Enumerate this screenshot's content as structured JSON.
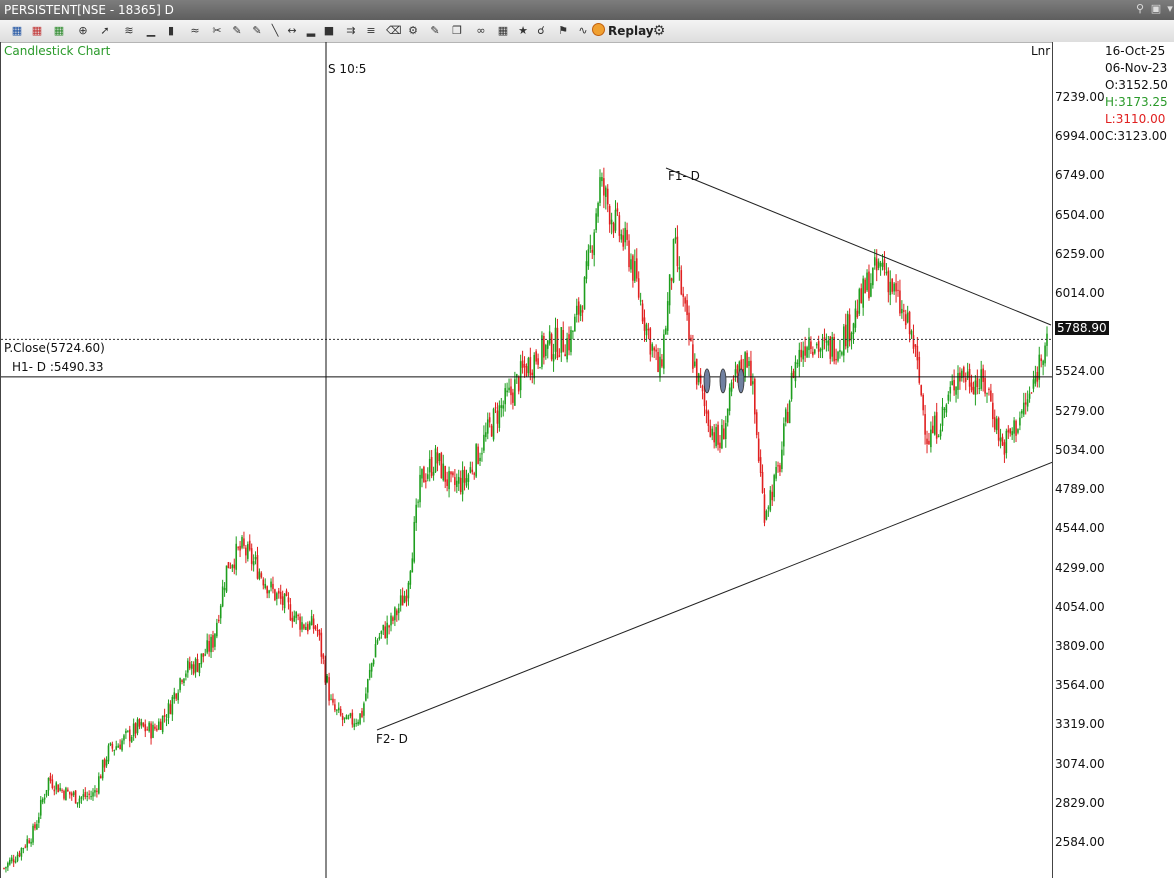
{
  "window": {
    "title": "PERSISTENT[NSE - 18365] D"
  },
  "toolbar": {
    "replay_label": "Replay"
  },
  "chart": {
    "type_label": "Candlestick Chart",
    "scale_label": "Lnr",
    "cursor_label": "S 10:5",
    "prev_close_label": "P.Close(5724.60)",
    "h1_label": "H1- D :5490.33",
    "f1_label": "F1- D",
    "f2_label": "F2- D",
    "last_price": "5788.90",
    "colors": {
      "up": "#1e9e1e",
      "down": "#e02020",
      "info_green": "#2a9a2a",
      "info_red": "#e02020"
    }
  },
  "info": {
    "date1": "16-Oct-25",
    "date2": "06-Nov-23",
    "open": "O:3152.50",
    "high": "H:3173.25",
    "low": "L:3110.00",
    "close": "C:3123.00"
  },
  "chart_data": {
    "type": "candlestick",
    "y_ticks": [
      7239.0,
      6994.0,
      6749.0,
      6504.0,
      6259.0,
      6014.0,
      5524.0,
      5279.0,
      5034.0,
      4789.0,
      4544.0,
      4299.0,
      4054.0,
      3809.0,
      3564.0,
      3319.0,
      3074.0,
      2829.0,
      2584.0
    ],
    "ylim": [
      2400,
      7450
    ],
    "prev_close": 5724.6,
    "h1_level": 5490.33,
    "last_price": 5788.9,
    "closes": [
      2420,
      2520,
      2650,
      2980,
      2900,
      2860,
      2880,
      3150,
      3220,
      3300,
      3280,
      3400,
      3650,
      3700,
      3830,
      4320,
      4420,
      4300,
      4150,
      4050,
      3950,
      3920,
      3420,
      3320,
      3380,
      3850,
      3950,
      4150,
      4850,
      4980,
      4800,
      4850,
      5050,
      5250,
      5380,
      5550,
      5650,
      5700,
      5720,
      6050,
      6700,
      6450,
      6250,
      5850,
      5500,
      6300,
      5700,
      5300,
      5050,
      5450,
      5640,
      4650,
      4900,
      5550,
      5750,
      5650,
      5700,
      5850,
      6080,
      6200,
      5950,
      5720,
      5100,
      5250,
      5520,
      5480,
      5420,
      5050,
      5200,
      5400,
      5788
    ]
  }
}
